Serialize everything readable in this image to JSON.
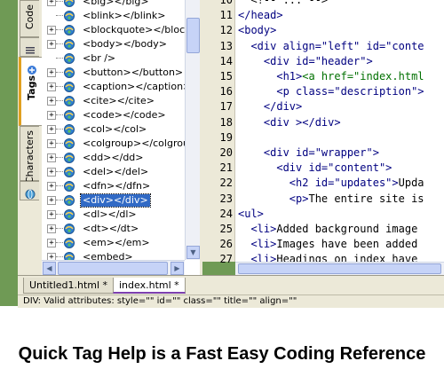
{
  "side_tabs": [
    {
      "label": "Code",
      "icon": "code-tab-icon"
    },
    {
      "label": "Tags",
      "icon": "tags-tab-icon"
    },
    {
      "label": "Characters",
      "icon": "characters-tab-icon"
    }
  ],
  "tag_tree": [
    {
      "text": "<big></big>",
      "expand": "+"
    },
    {
      "text": "<blink></blink>",
      "expand": ""
    },
    {
      "text": "<blockquote></blockquo",
      "expand": "+"
    },
    {
      "text": "<body></body>",
      "expand": "+"
    },
    {
      "text": "<br />",
      "expand": ""
    },
    {
      "text": "<button></button>",
      "expand": "+"
    },
    {
      "text": "<caption></caption>",
      "expand": "+"
    },
    {
      "text": "<cite></cite>",
      "expand": "+"
    },
    {
      "text": "<code></code>",
      "expand": "+"
    },
    {
      "text": "<col></col>",
      "expand": "+"
    },
    {
      "text": "<colgroup></colgroup>",
      "expand": "+"
    },
    {
      "text": "<dd></dd>",
      "expand": "+"
    },
    {
      "text": "<del></del>",
      "expand": "+"
    },
    {
      "text": "<dfn></dfn>",
      "expand": "+"
    },
    {
      "text": "<div></div>",
      "expand": "+",
      "selected": true
    },
    {
      "text": "<dl></dl>",
      "expand": "+"
    },
    {
      "text": "<dt></dt>",
      "expand": "+"
    },
    {
      "text": "<em></em>",
      "expand": "+"
    },
    {
      "text": "<embed>",
      "expand": "+"
    }
  ],
  "code_lines": [
    {
      "n": "10",
      "parts": [
        {
          "t": "  <!-- ... -->",
          "c": "plain"
        }
      ]
    },
    {
      "n": "11",
      "parts": [
        {
          "t": "</head>",
          "c": "tag"
        }
      ]
    },
    {
      "n": "12",
      "parts": [
        {
          "t": "<body>",
          "c": "tag"
        }
      ]
    },
    {
      "n": "13",
      "parts": [
        {
          "t": "  <div align=\"left\" id=\"conte",
          "c": "tag"
        }
      ]
    },
    {
      "n": "14",
      "parts": [
        {
          "t": "    <div id=\"header\">",
          "c": "tag"
        }
      ]
    },
    {
      "n": "15",
      "parts": [
        {
          "t": "      <h1>",
          "c": "tag"
        },
        {
          "t": "<a href=\"index.html",
          "c": "green"
        }
      ]
    },
    {
      "n": "16",
      "parts": [
        {
          "t": "      <p class=\"description\">",
          "c": "tag"
        }
      ]
    },
    {
      "n": "17",
      "parts": [
        {
          "t": "    </div>",
          "c": "tag"
        }
      ]
    },
    {
      "n": "18",
      "parts": [
        {
          "t": "    <div ></div>",
          "c": "tag"
        }
      ]
    },
    {
      "n": "19",
      "parts": [
        {
          "t": "",
          "c": "plain"
        }
      ]
    },
    {
      "n": "20",
      "parts": [
        {
          "t": "    <div id=\"wrapper\">",
          "c": "tag"
        }
      ]
    },
    {
      "n": "21",
      "parts": [
        {
          "t": "      <div id=\"content\">",
          "c": "tag"
        }
      ]
    },
    {
      "n": "22",
      "parts": [
        {
          "t": "        <h2 id=\"updates\">",
          "c": "tag"
        },
        {
          "t": "Upda",
          "c": "plain"
        }
      ]
    },
    {
      "n": "23",
      "parts": [
        {
          "t": "        <p>",
          "c": "tag"
        },
        {
          "t": "The entire site is",
          "c": "plain"
        }
      ]
    },
    {
      "n": "24",
      "parts": [
        {
          "t": "<ul>",
          "c": "tag"
        }
      ]
    },
    {
      "n": "25",
      "parts": [
        {
          "t": "  <li>",
          "c": "tag"
        },
        {
          "t": "Added background image",
          "c": "plain"
        }
      ]
    },
    {
      "n": "26",
      "parts": [
        {
          "t": "  <li>",
          "c": "tag"
        },
        {
          "t": "Images have been added",
          "c": "plain"
        }
      ]
    },
    {
      "n": "27",
      "parts": [
        {
          "t": "  <li>",
          "c": "tag"
        },
        {
          "t": "Headings on index have",
          "c": "plain"
        }
      ]
    }
  ],
  "doc_tabs": [
    {
      "label": "Untitled1.html *",
      "active": false
    },
    {
      "label": "index.html *",
      "active": true
    }
  ],
  "status_text": "DIV: Valid attributes: style=\"\" id=\"\" class=\"\" title=\"\" align=\"\"",
  "caption": "Quick Tag Help is a Fast Easy Coding Reference",
  "colors": {
    "tag": "#000080",
    "green": "#007000",
    "selection": "#316ac5",
    "accent_tab": "#7d3fb0"
  }
}
